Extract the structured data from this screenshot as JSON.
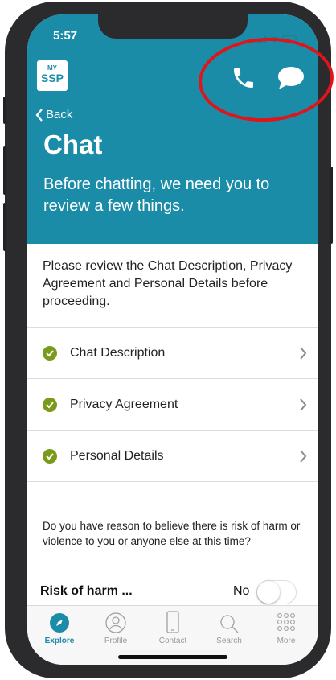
{
  "status_bar": {
    "time": "5:57"
  },
  "header": {
    "logo_line1": "MY",
    "logo_line2": "SSP",
    "back_label": "Back",
    "title": "Chat",
    "subtitle": "Before chatting, we need you to review a few things.",
    "phone_icon": "phone-icon",
    "chat_icon": "chat-bubble-icon"
  },
  "content": {
    "intro": "Please review the Chat Description, Privacy Agreement and Personal Details before proceeding.",
    "items": [
      {
        "label": "Chat Description"
      },
      {
        "label": "Privacy Agreement"
      },
      {
        "label": "Personal Details"
      }
    ],
    "question": "Do you have reason to believe there is risk of harm or violence to you or anyone else at this time?",
    "risk_label": "Risk of harm ...",
    "toggle_value": "No"
  },
  "tabbar": {
    "tabs": [
      {
        "label": "Explore"
      },
      {
        "label": "Profile"
      },
      {
        "label": "Contact"
      },
      {
        "label": "Search"
      },
      {
        "label": "More"
      }
    ]
  },
  "colors": {
    "accent": "#1a8ca8",
    "check": "#7a9a1c",
    "highlight": "#e0141b"
  }
}
